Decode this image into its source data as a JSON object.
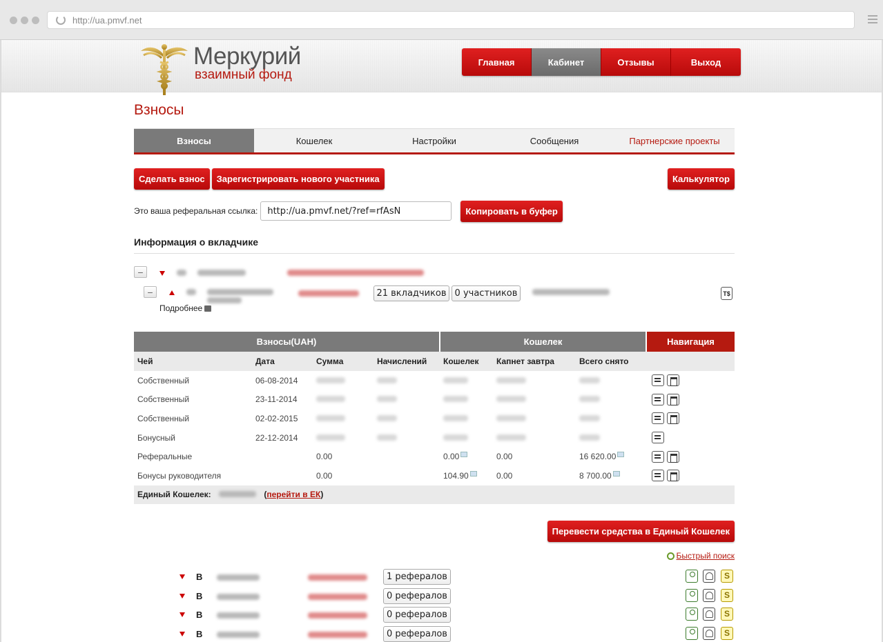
{
  "browser": {
    "url": "http://ua.pmvf.net"
  },
  "logo": {
    "name": "Меркурий",
    "sub": "взаимный фонд"
  },
  "topnav": [
    "Главная",
    "Кабинет",
    "Отзывы",
    "Выход"
  ],
  "page_title": "Взносы",
  "tabs": [
    "Взносы",
    "Кошелек",
    "Настройки",
    "Сообщения",
    "Партнерские проекты"
  ],
  "buttons": {
    "make_contribution": "Сделать взнос",
    "register": "Зарегистрировать нового участника",
    "calculator": "Калькулятор",
    "copy": "Копировать в буфер",
    "transfer": "Перевести средства в Единый Кошелек"
  },
  "referral": {
    "label": "Это ваша реферальная ссылка:",
    "value": "http://ua.pmvf.net/?ref=rfAsN"
  },
  "info_heading": "Информация о вкладчике",
  "tree": {
    "depositors": "21 вкладчиков",
    "participants": "0 участников",
    "more": "Подробнее"
  },
  "table": {
    "groups": [
      "Взносы(UAH)",
      "Кошелек",
      "Навигация"
    ],
    "columns": [
      "Чей",
      "Дата",
      "Сумма",
      "Начислений",
      "Кошелек",
      "Капнет завтра",
      "Всего снято"
    ],
    "rows": [
      {
        "who": "Собственный",
        "date": "06-08-2014",
        "sum": "",
        "acc": "",
        "wallet": "",
        "tomorrow": "",
        "total": "",
        "gift": true
      },
      {
        "who": "Собственный",
        "date": "23-11-2014",
        "sum": "",
        "acc": "",
        "wallet": "",
        "tomorrow": "",
        "total": "",
        "gift": true
      },
      {
        "who": "Собственный",
        "date": "02-02-2015",
        "sum": "",
        "acc": "",
        "wallet": "",
        "tomorrow": "",
        "total": "",
        "gift": true
      },
      {
        "who": "Бонусный",
        "date": "22-12-2014",
        "sum": "",
        "acc": "",
        "wallet": "",
        "tomorrow": "",
        "total": "",
        "gift": false
      },
      {
        "who": "Реферальные",
        "date": "",
        "sum": "0.00",
        "acc": "",
        "wallet": "0.00",
        "tomorrow": "0.00",
        "total": "16 620.00",
        "gift": true
      },
      {
        "who": "Бонусы руководителя",
        "date": "",
        "sum": "0.00",
        "acc": "",
        "wallet": "104.90",
        "tomorrow": "0.00",
        "total": "8 700.00",
        "gift": true
      }
    ],
    "footer_label": "Единый Кошелек:",
    "footer_link": "перейти в ЕК"
  },
  "quick_search": "Быстрый поиск",
  "referrals": [
    {
      "letter": "В",
      "count": "1 рефералов"
    },
    {
      "letter": "В",
      "count": "0 рефералов"
    },
    {
      "letter": "В",
      "count": "0 рефералов"
    },
    {
      "letter": "В",
      "count": "0 рефералов"
    }
  ]
}
